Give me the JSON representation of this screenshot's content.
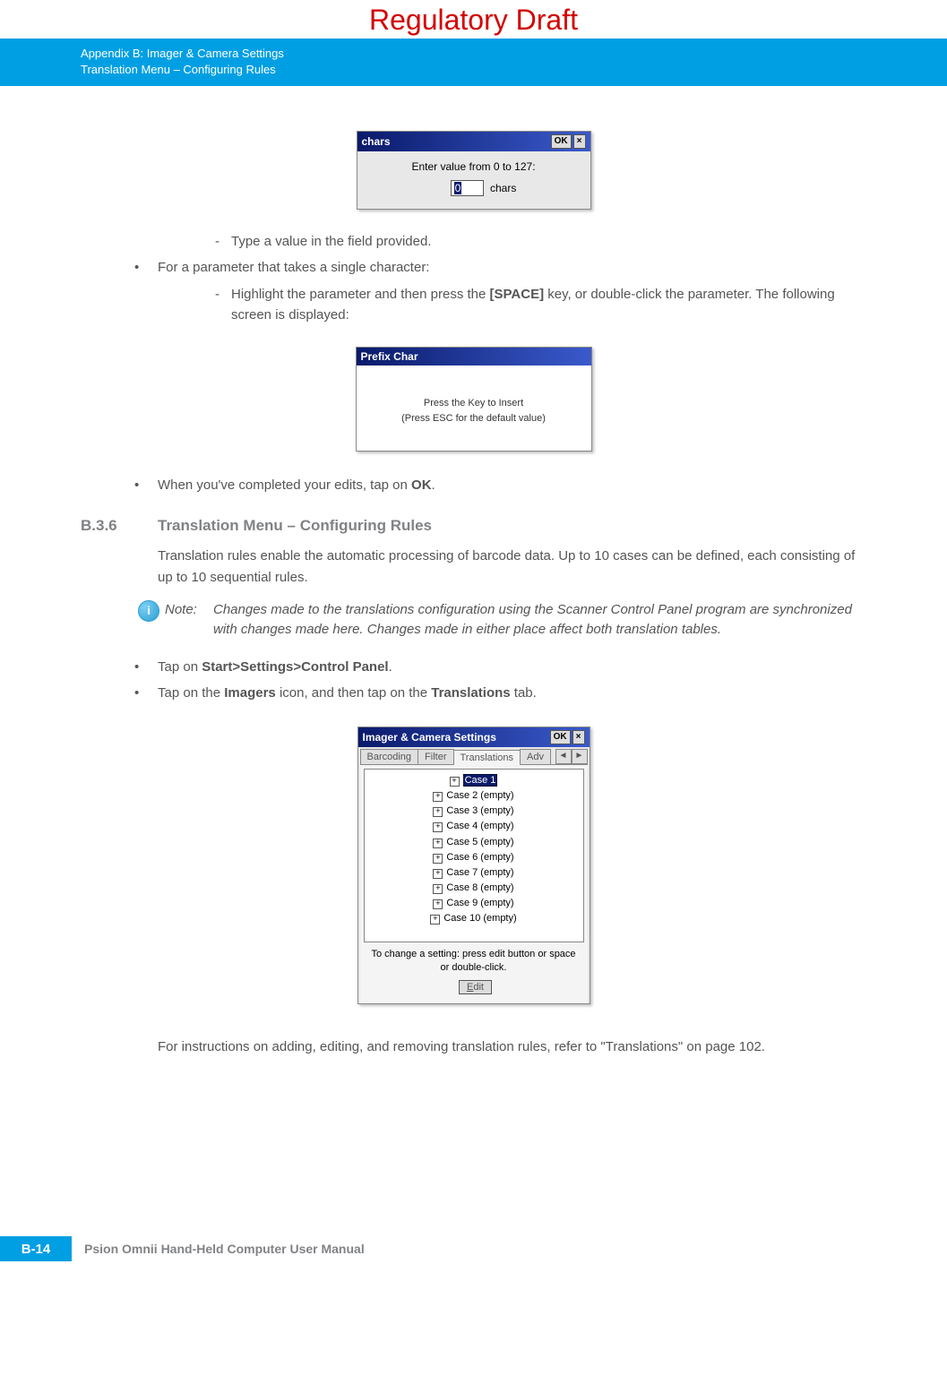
{
  "watermark": "Regulatory Draft",
  "header": {
    "line1": "Appendix B: Imager & Camera Settings",
    "line2": "Translation Menu – Configuring Rules"
  },
  "dialog1": {
    "title": "chars",
    "ok": "OK",
    "close": "×",
    "prompt": "Enter value from 0 to 127:",
    "value": "0",
    "unit": "chars"
  },
  "steps": {
    "s1": "Type a value in the field provided.",
    "s2": "For a parameter that takes a single character:",
    "s3a": "Highlight the parameter and then press the ",
    "s3_key": "[SPACE]",
    "s3b": " key, or double-click the parameter. The following screen is displayed:",
    "s4a": "When you've completed your edits, tap on ",
    "s4_key": "OK",
    "s4b": "."
  },
  "dialog2": {
    "title": "Prefix Char",
    "line1": "Press the Key to Insert",
    "line2": "(Press ESC for the default value)"
  },
  "section": {
    "num": "B.3.6",
    "title": "Translation Menu – Configuring Rules",
    "body": "Translation rules enable the automatic processing of barcode data. Up to 10 cases can be defined, each consisting of up to 10 sequential rules."
  },
  "note": {
    "label": "Note:",
    "text": "Changes made to the translations configuration using the Scanner Control Panel program are synchronized with changes made here. Changes made in either place affect both translation tables."
  },
  "steps2": {
    "a1": "Tap on ",
    "a2": "Start>Settings>Control Panel",
    "a3": ".",
    "b1": "Tap on the ",
    "b2": "Imagers",
    "b3": " icon, and then tap on the ",
    "b4": "Translations",
    "b5": " tab."
  },
  "dialog3": {
    "title": "Imager & Camera Settings",
    "ok": "OK",
    "close": "×",
    "tabs": {
      "t1": "Barcoding",
      "t2": "Filter",
      "t3": "Translations",
      "t4": "Adv"
    },
    "tree": [
      "Case 1",
      "Case 2 (empty)",
      "Case 3 (empty)",
      "Case 4 (empty)",
      "Case 5 (empty)",
      "Case 6 (empty)",
      "Case 7 (empty)",
      "Case 8 (empty)",
      "Case 9 (empty)",
      "Case 10 (empty)"
    ],
    "hint": "To change a setting: press edit button or space or double-click.",
    "edit": "Edit"
  },
  "after": "For instructions on adding, editing, and removing translation rules, refer to \"Translations\" on page 102.",
  "footer": {
    "page": "B-14",
    "manual": "Psion Omnii Hand-Held Computer User Manual"
  }
}
